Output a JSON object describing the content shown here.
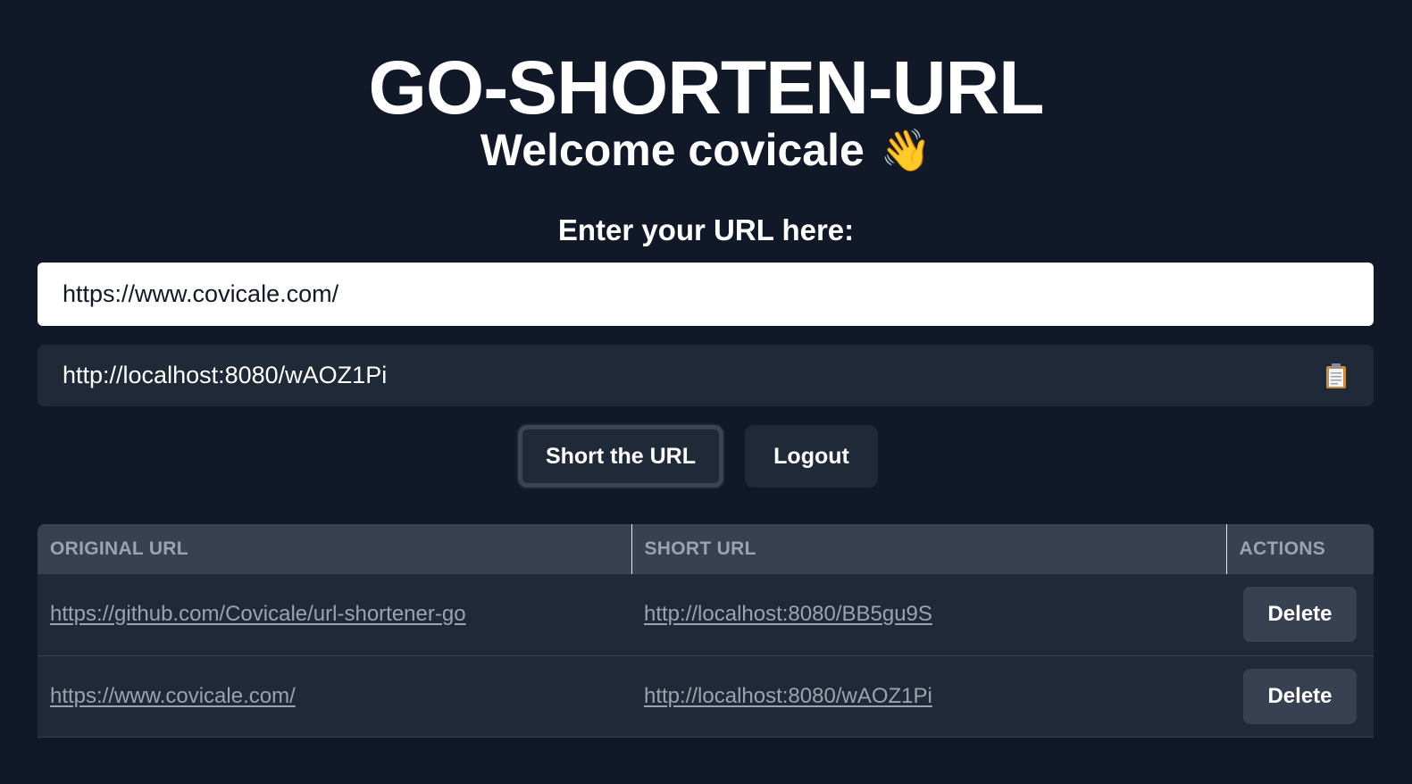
{
  "header": {
    "title": "GO-SHORTEN-URL",
    "welcome": "Welcome covicale",
    "wave_icon": "👋"
  },
  "form": {
    "prompt": "Enter your URL here:",
    "url_value": "https://www.covicale.com/",
    "result": "http://localhost:8080/wAOZ1Pi",
    "clipboard_icon": "📋",
    "short_button": "Short the URL",
    "logout_button": "Logout"
  },
  "table": {
    "headers": [
      "ORIGINAL URL",
      "SHORT URL",
      "ACTIONS"
    ],
    "rows": [
      {
        "original": "https://github.com/Covicale/url-shortener-go",
        "short": "http://localhost:8080/BB5gu9S",
        "action": "Delete"
      },
      {
        "original": "https://www.covicale.com/",
        "short": "http://localhost:8080/wAOZ1Pi",
        "action": "Delete"
      }
    ]
  },
  "colors": {
    "background": "#111827",
    "panel": "#1f2937",
    "header_row": "#374151",
    "muted_text": "#9ca3af"
  }
}
